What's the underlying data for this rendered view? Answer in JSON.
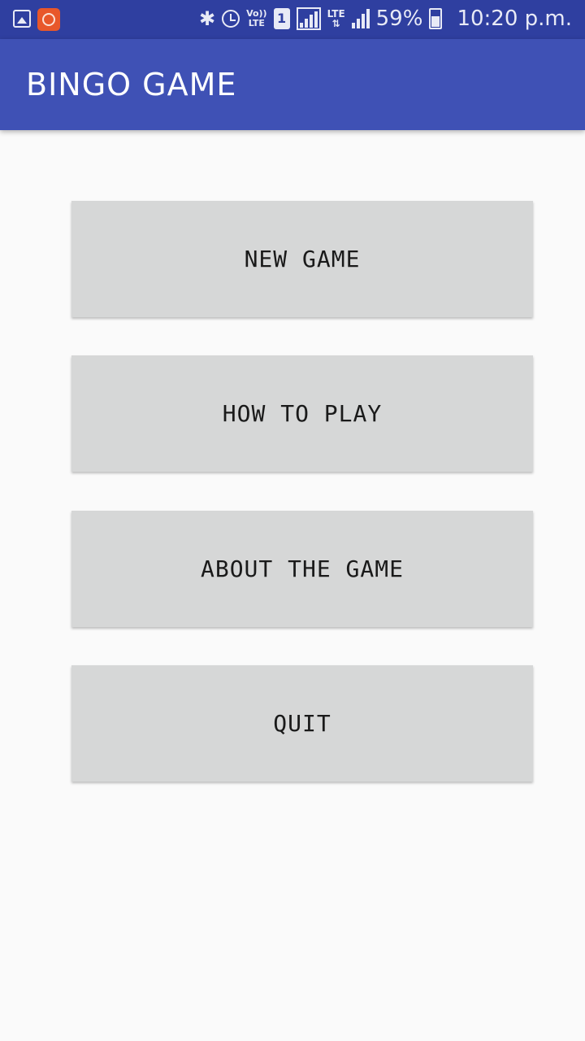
{
  "status_bar": {
    "notification_icons": [
      "gallery-icon",
      "app-notification-icon"
    ],
    "system_icons": [
      "bluetooth-icon",
      "alarm-icon",
      "volte-icon",
      "sim1-icon",
      "signal-icon",
      "lte-icon",
      "signal-icon"
    ],
    "volte_top": "Vo))",
    "volte_bottom": "LTE",
    "sim_label": "1",
    "lte_label": "LTE",
    "battery_percent": "59%",
    "time": "10:20 p.m."
  },
  "app_bar": {
    "title": "BINGO GAME",
    "color": "#3f51b5"
  },
  "menu": {
    "new_game": "NEW GAME",
    "how_to_play": "HOW TO PLAY",
    "about_the_game": "ABOUT THE GAME",
    "quit": "QUIT"
  },
  "colors": {
    "status_bar": "#2f3fa0",
    "button_bg": "#d6d7d7",
    "background": "#fafafa"
  }
}
